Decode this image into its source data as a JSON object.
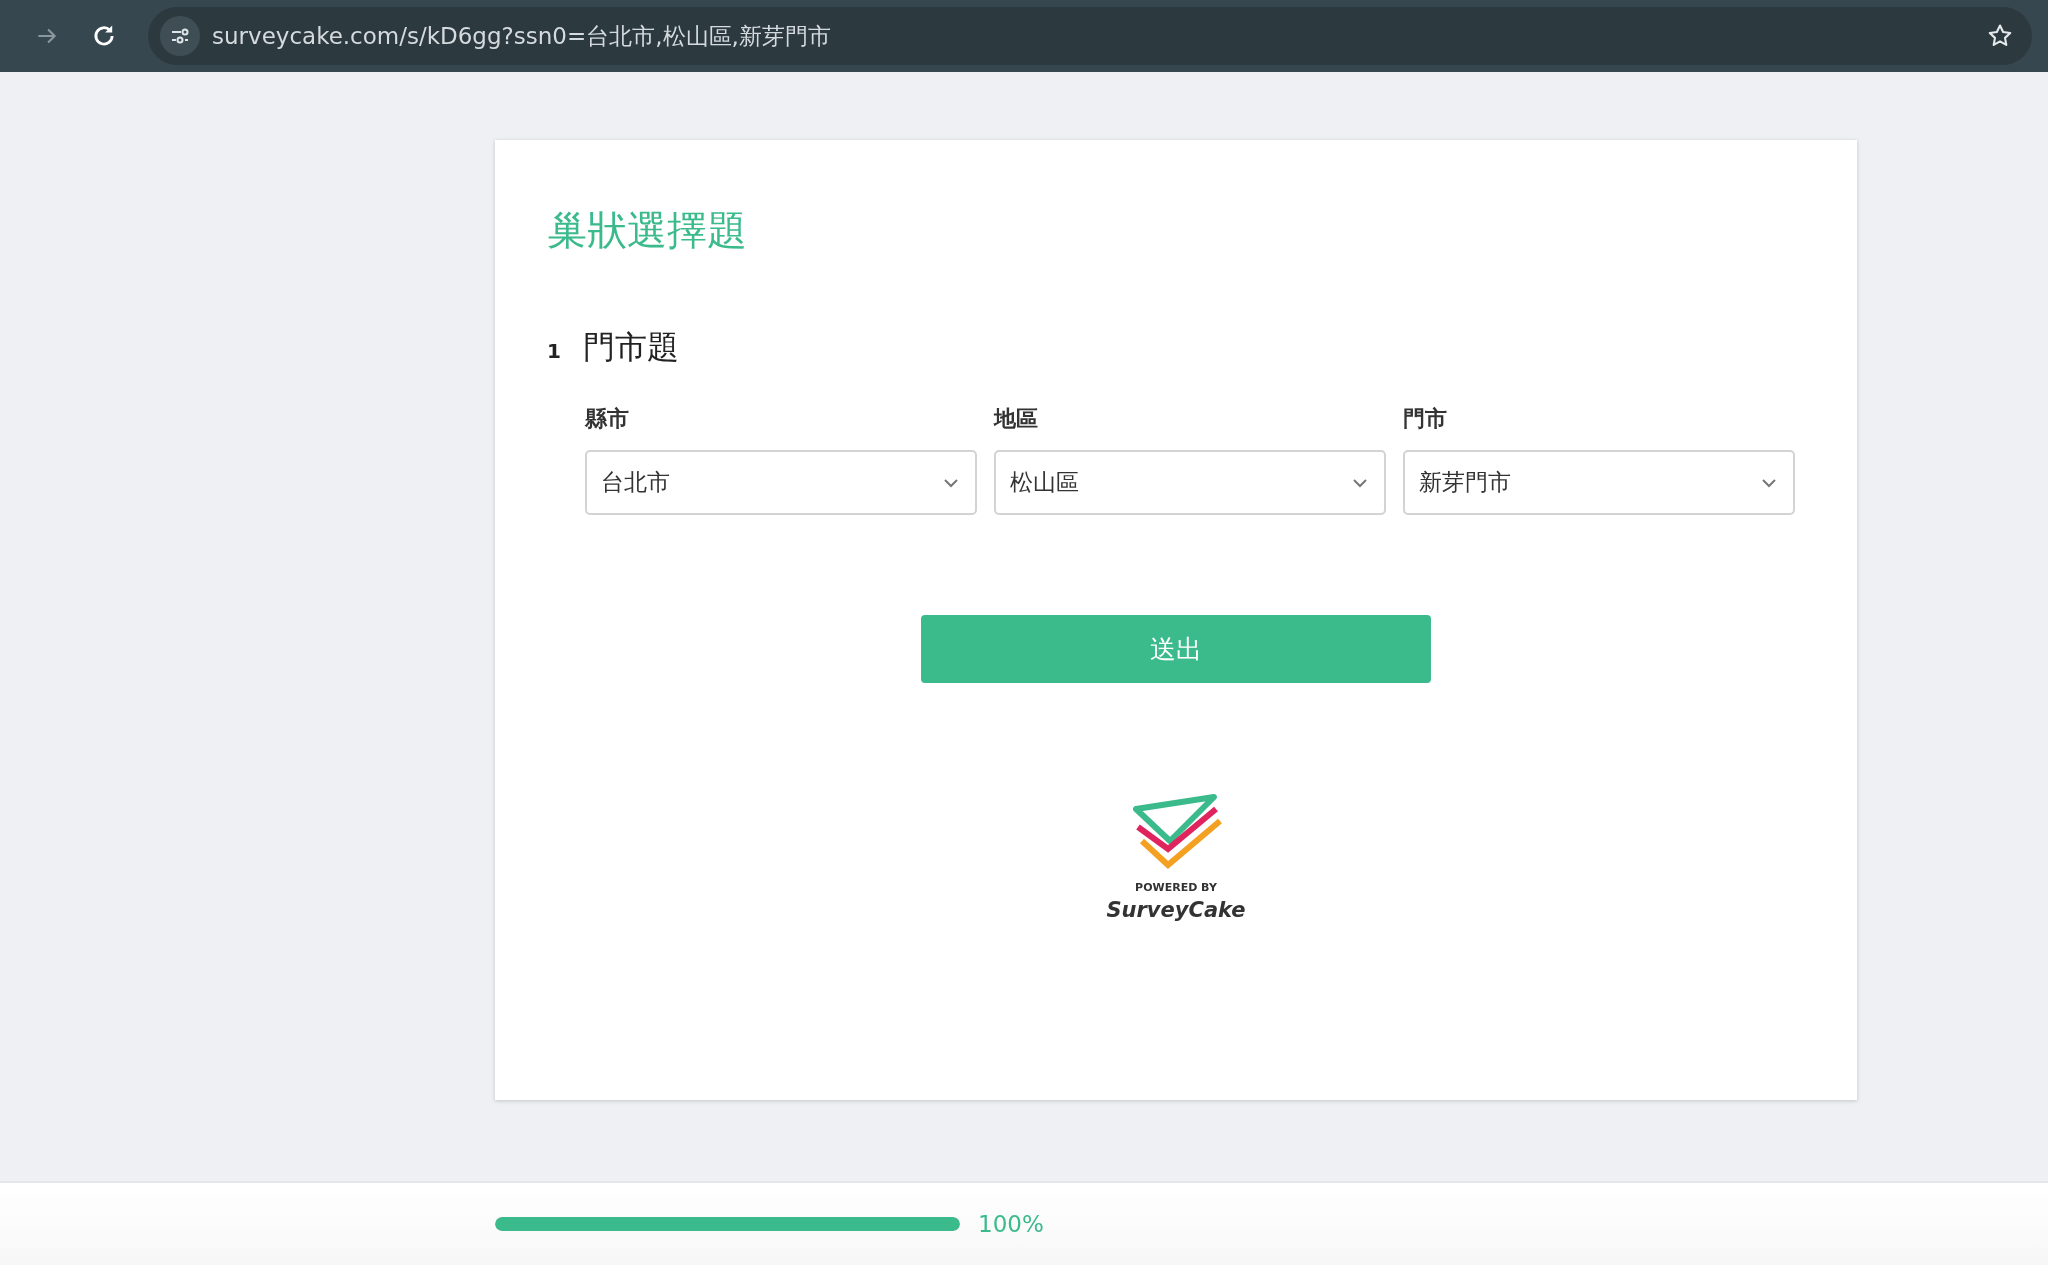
{
  "browser": {
    "url": "surveycake.com/s/kD6gg?ssn0=台北市,松山區,新芽門市"
  },
  "survey": {
    "title": "巢狀選擇題",
    "question": {
      "number": "1",
      "title": "門市題",
      "selects": [
        {
          "label": "縣市",
          "value": "台北市"
        },
        {
          "label": "地區",
          "value": "松山區"
        },
        {
          "label": "門市",
          "value": "新芽門市"
        }
      ]
    },
    "submit": "送出",
    "branding": {
      "powered_by": "POWERED BY",
      "name": "SurveyCake"
    }
  },
  "progress": {
    "level": 1,
    "reading": "100%"
  }
}
